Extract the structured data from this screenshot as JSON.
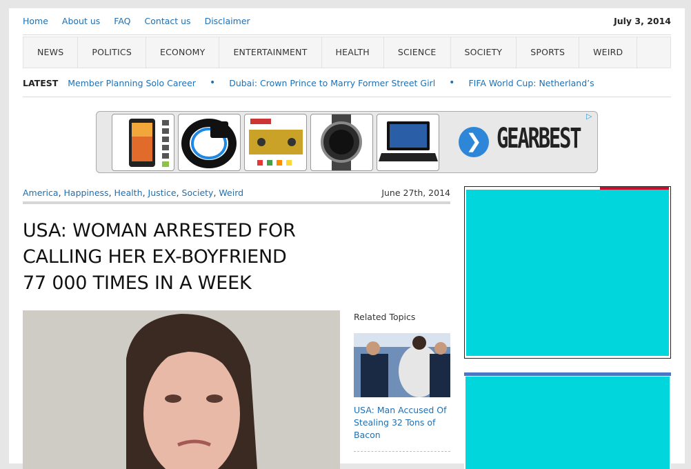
{
  "top_nav": [
    "Home",
    "About us",
    "FAQ",
    "Contact us",
    "Disclaimer"
  ],
  "current_date": "July 3, 2014",
  "main_nav": [
    "NEWS",
    "POLITICS",
    "ECONOMY",
    "ENTERTAINMENT",
    "HEALTH",
    "SCIENCE",
    "SOCIETY",
    "SPORTS",
    "WEIRD"
  ],
  "latest": {
    "label": "LATEST",
    "items": [
      "Member Planning Solo Career",
      "Dubai: Crown Prince to Marry Former Street Girl",
      "FIFA World Cup: Netherland’s"
    ]
  },
  "ad": {
    "brand": "GEARBEST",
    "arrow": "❯",
    "adchoice": "▷"
  },
  "article": {
    "categories": [
      "America",
      "Happiness",
      "Health",
      "Justice",
      "Society",
      "Weird"
    ],
    "date": "June 27th, 2014",
    "headline_lines": [
      "USA: WOMAN ARRESTED FOR",
      "CALLING HER EX-BOYFRIEND",
      "77 000 TIMES IN A WEEK"
    ]
  },
  "related": {
    "title": "Related Topics",
    "link_lines": [
      "USA: Man Accused Of",
      "Stealing 32 Tons of",
      "Bacon"
    ]
  },
  "colors": {
    "link": "#1f6fb2",
    "ad_fill": "#00d6dc",
    "accent_red": "#c8102e"
  }
}
